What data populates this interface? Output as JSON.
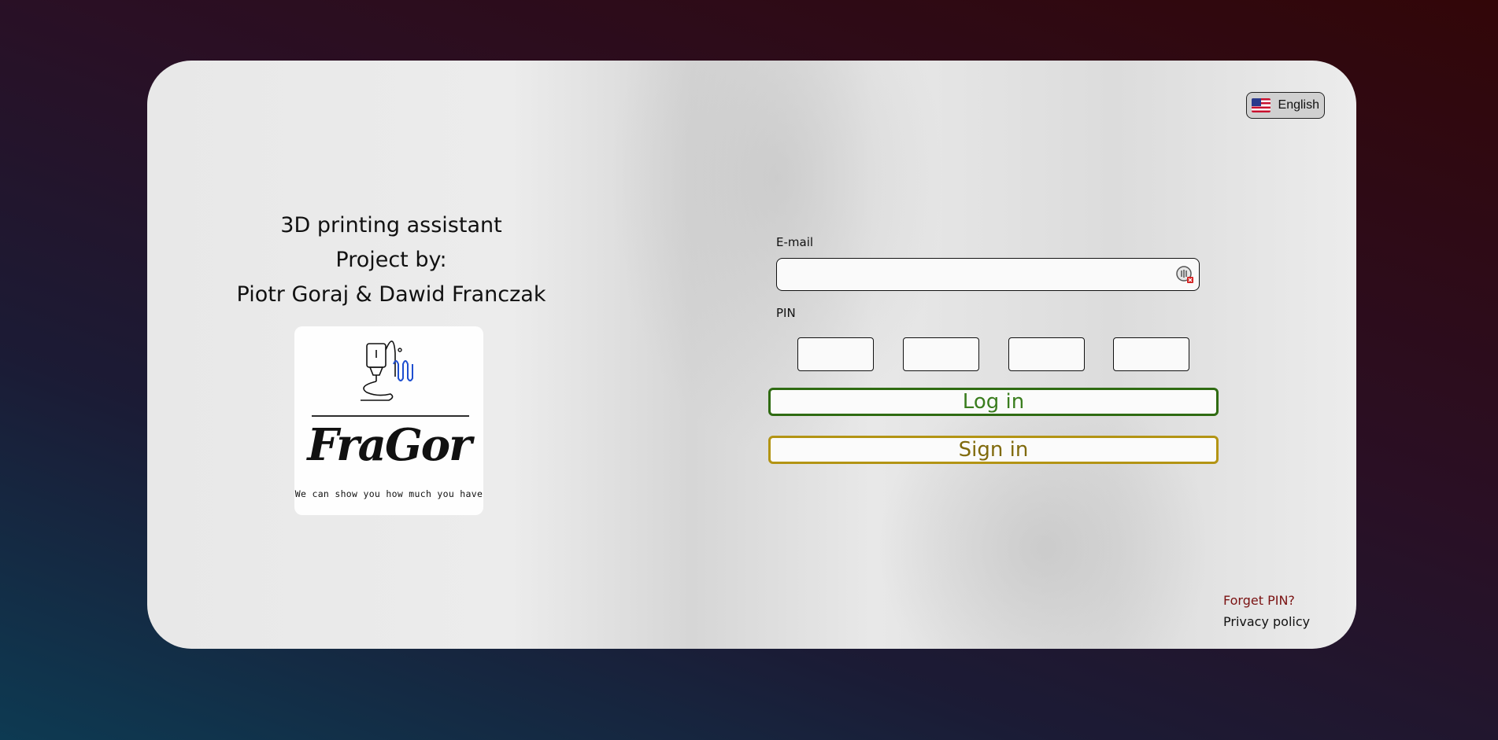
{
  "language": {
    "label": "English",
    "flag_icon": "us-flag-icon"
  },
  "intro": {
    "line1": "3D printing assistant",
    "line2": "Project by:",
    "line3": "Piotr Goraj & Dawid Franczak"
  },
  "logo": {
    "wordmark": "FraGor",
    "tagline": "We can show you how much you have",
    "icon": "3d-printer-nozzle-icon"
  },
  "form": {
    "email_label": "E-mail",
    "email_value": "",
    "email_icon": "password-manager-icon",
    "pin_label": "PIN",
    "pin_values": [
      "",
      "",
      "",
      ""
    ],
    "login_label": "Log in",
    "signin_label": "Sign in"
  },
  "links": {
    "forget_pin": "Forget PIN?",
    "privacy_policy": "Privacy policy"
  },
  "colors": {
    "login_border": "#2f6b12",
    "signin_border": "#b39414",
    "forget_link": "#7a1212"
  }
}
